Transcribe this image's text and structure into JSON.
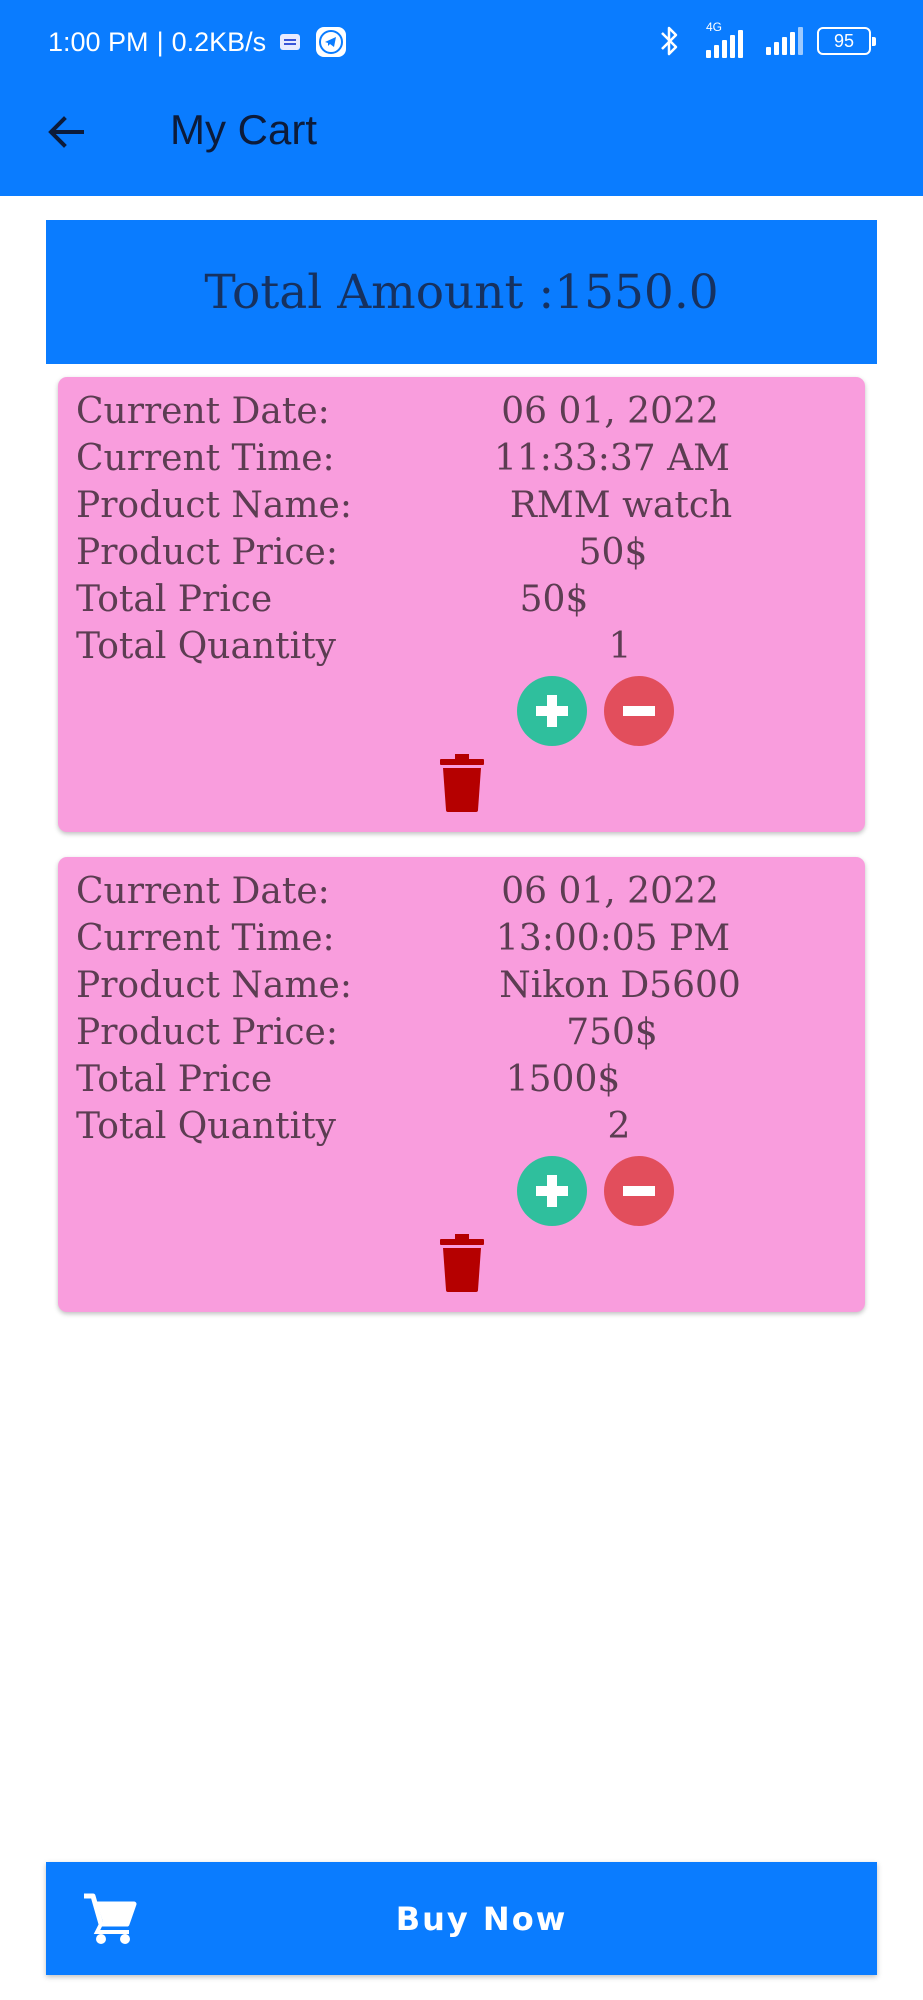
{
  "status_bar": {
    "time": "1:00 PM",
    "speed": "0.2KB/s",
    "network_type": "4G",
    "battery": "95"
  },
  "app_bar": {
    "title": "My Cart",
    "back_icon": "arrow-left-icon"
  },
  "summary": {
    "total_amount_text": "Total Amount :1550.0"
  },
  "labels": {
    "current_date": "Current Date:",
    "current_time": "Current Time:",
    "product_name": "Product Name:",
    "product_price": "Product Price:",
    "total_price": "Total Price",
    "total_quantity": "Total Quantity"
  },
  "cart_items": [
    {
      "current_date": "06 01, 2022",
      "current_time": "11:33:37 AM",
      "product_name": "RMM watch",
      "product_price": "50$",
      "total_price": "50$",
      "total_quantity": "1"
    },
    {
      "current_date": "06 01, 2022",
      "current_time": "13:00:05 PM",
      "product_name": "Nikon D5600",
      "product_price": "750$",
      "total_price": "1500$",
      "total_quantity": "2"
    }
  ],
  "icons": {
    "plus": "plus-circle-icon",
    "minus": "minus-circle-icon",
    "delete": "trash-icon",
    "cart": "shopping-cart-icon"
  },
  "colors": {
    "primary": "#0a7cff",
    "card": "#f99ddd",
    "plus": "#2fbf9d",
    "minus": "#e24e5c",
    "delete": "#b50000"
  },
  "buy_button": {
    "label": "Buy Now"
  }
}
